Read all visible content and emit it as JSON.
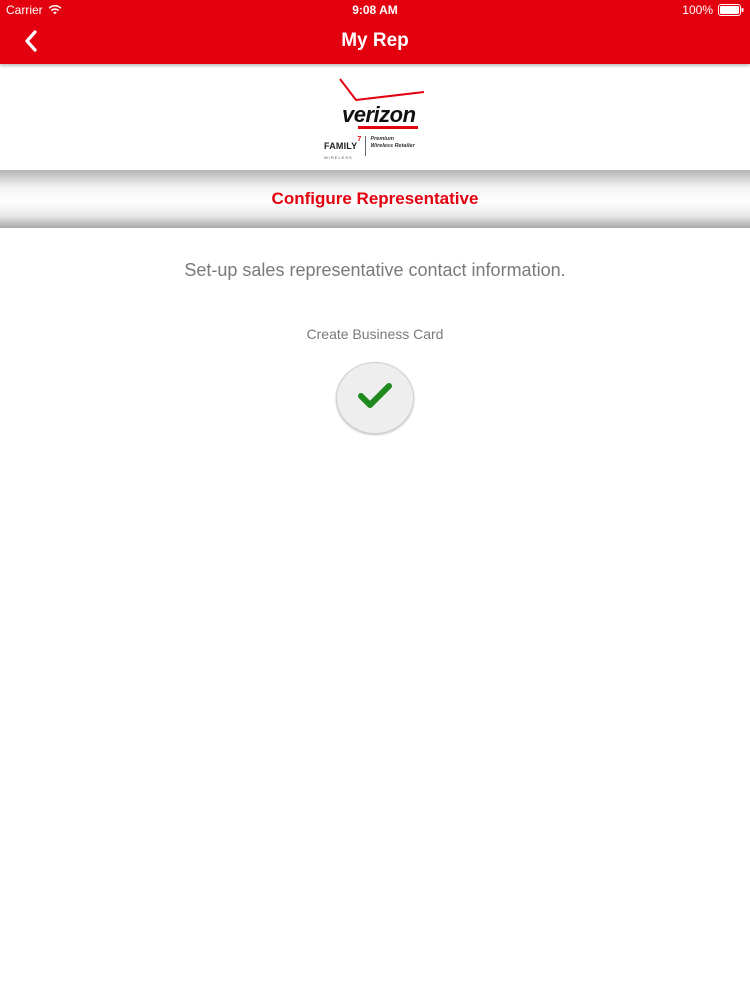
{
  "status_bar": {
    "carrier": "Carrier",
    "time": "9:08 AM",
    "battery": "100%"
  },
  "nav": {
    "title": "My Rep",
    "back_icon": "chevron-left-icon"
  },
  "logo": {
    "brand": "verizon",
    "family": "FAMILY",
    "family_mark": "7",
    "family_sub": "WIRELESS",
    "premium_line1": "Premium",
    "premium_line2": "Wireless Retailer"
  },
  "section": {
    "title": "Configure Representative"
  },
  "main": {
    "subtitle": "Set-up sales representative contact information.",
    "card_label": "Create Business Card",
    "check_icon": "checkmark-icon"
  },
  "colors": {
    "brand_red": "#e3000f",
    "check_green": "#1e8a1e",
    "text_gray": "#7a7a7a"
  }
}
